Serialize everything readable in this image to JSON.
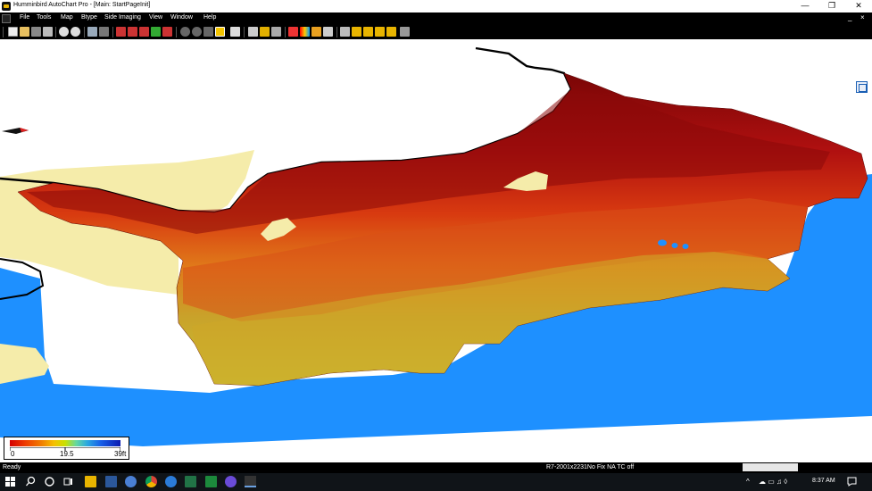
{
  "window": {
    "title": "Humminbird AutoChart Pro - [Main: StartPageInit]",
    "minimize_glyph": "—",
    "restore_glyph": "❐",
    "close_glyph": "✕",
    "icon": "humminbird-app-icon"
  },
  "menu": {
    "items": [
      "File",
      "Tools",
      "Map",
      "Btype",
      "Side Imaging",
      "View",
      "Window",
      "Help"
    ],
    "mdi_minimize": "_",
    "mdi_close": "×"
  },
  "toolbar": {
    "buttons": [
      "new-icon",
      "open-icon",
      "save-icon",
      "print-icon",
      "zoom-in-icon",
      "zoom-out-icon",
      "fit-icon",
      "chart-icon",
      "import-left-icon",
      "import-icon",
      "export-icon",
      "export-right-icon",
      "upload-icon",
      "circle-tool-icon",
      "circle-tool-2-icon",
      "square-tool-icon",
      "3d-cube-icon",
      "page-icon",
      "route-icon",
      "shield-icon",
      "boat-icon",
      "waypoint-icon",
      "palette-icon",
      "contour-icon",
      "layer-icon",
      "grid-icon",
      "house-icon",
      "camera-icon",
      "fish-icon",
      "signal-icon",
      "pen-icon"
    ]
  },
  "map": {
    "water_color": "#1e90ff",
    "land_color": "#f5ecaa",
    "depth_shallow_color": "#c8c436",
    "depth_deep_color": "#8a0a0a"
  },
  "legend": {
    "min": "0",
    "mid": "19.5",
    "max": "39ft",
    "colors": [
      "#d40000",
      "#f07a00",
      "#f5c000",
      "#c9e000",
      "#64d8a0",
      "#2aa8e0",
      "#1860e8",
      "#0a1ab0"
    ]
  },
  "status": {
    "ready": "Ready",
    "info": "R7-2001x2231No Fix   NA  TC off"
  },
  "taskbar": {
    "apps": [
      "windows-start-icon",
      "search-icon",
      "cortana-icon",
      "task-view-icon",
      "file-explorer-icon",
      "word-icon",
      "app-blue-icon",
      "chrome-icon",
      "app-circle-icon",
      "excel-icon",
      "app-green-icon",
      "app-j-icon",
      "humminbird-taskbar-icon"
    ],
    "clock": "8:37 AM",
    "tray_chevron": "^",
    "tray_icons": "☁ ▭ ♫ ◊"
  }
}
